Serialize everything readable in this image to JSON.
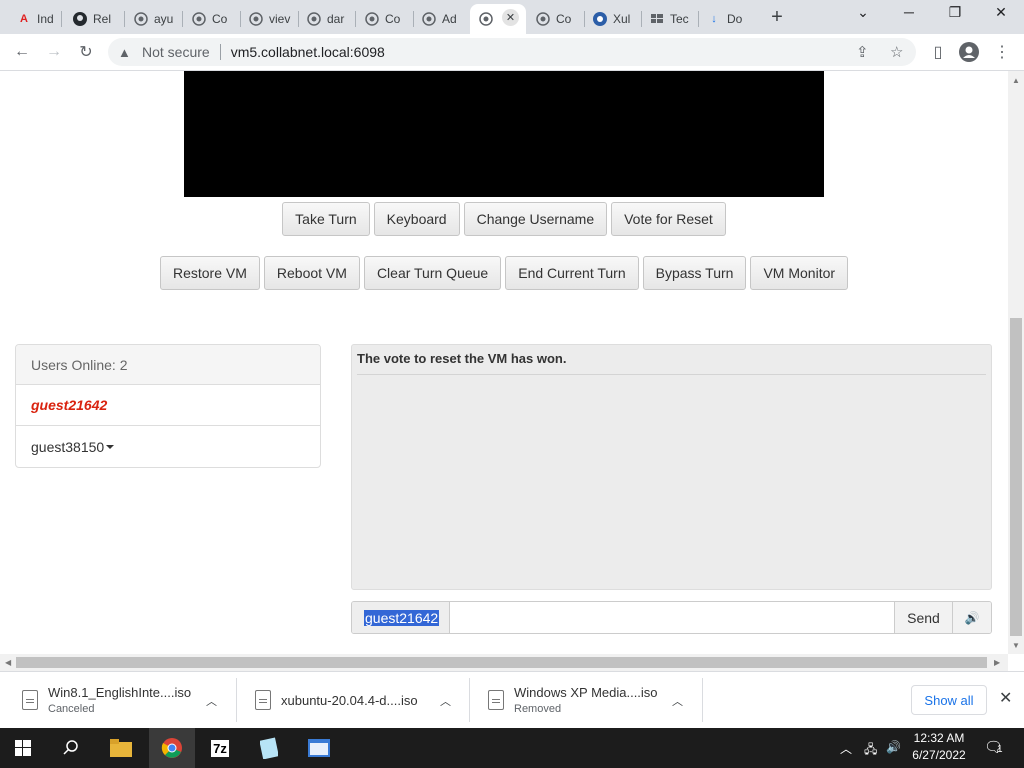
{
  "browser": {
    "tabs": [
      {
        "label": "Ind",
        "icon": "adobe-acrobat-icon"
      },
      {
        "label": "Rel",
        "icon": "github-icon"
      },
      {
        "label": "ayu",
        "icon": "globe-icon"
      },
      {
        "label": "Co",
        "icon": "globe-icon"
      },
      {
        "label": "viev",
        "icon": "globe-icon"
      },
      {
        "label": "dar",
        "icon": "globe-icon"
      },
      {
        "label": "Co",
        "icon": "globe-icon"
      },
      {
        "label": "Ad",
        "icon": "globe-icon"
      },
      {
        "label": "",
        "icon": "globe-icon",
        "active": true
      },
      {
        "label": "Co",
        "icon": "globe-icon"
      },
      {
        "label": "Xul",
        "icon": "xubuntu-icon"
      },
      {
        "label": "Tec",
        "icon": "windows-flag-icon"
      },
      {
        "label": "Do",
        "icon": "download-icon"
      }
    ],
    "security_label": "Not secure",
    "url": "vm5.collabnet.local:6098"
  },
  "vm": {
    "buttons_row1": [
      "Take Turn",
      "Keyboard",
      "Change Username",
      "Vote for Reset"
    ],
    "buttons_row2": [
      "Restore VM",
      "Reboot VM",
      "Clear Turn Queue",
      "End Current Turn",
      "Bypass Turn",
      "VM Monitor"
    ]
  },
  "users": {
    "header": "Users Online: 2",
    "list": [
      {
        "name": "guest21642",
        "is_self": true
      },
      {
        "name": "guest38150",
        "is_self": false
      }
    ]
  },
  "chat": {
    "messages": [
      "The vote to reset the VM has won."
    ],
    "username": "guest21642",
    "input_value": "",
    "send_label": "Send"
  },
  "downloads": [
    {
      "name": "Win8.1_EnglishInte....iso",
      "status": "Canceled"
    },
    {
      "name": "xubuntu-20.04.4-d....iso",
      "status": ""
    },
    {
      "name": "Windows XP Media....iso",
      "status": "Removed"
    }
  ],
  "downloads_show_all": "Show all",
  "taskbar": {
    "time": "12:32 AM",
    "date": "6/27/2022",
    "notification_count": "1"
  },
  "colors": {
    "self_user": "#d9230f",
    "vm_screen": "#000000",
    "link": "#1a73e8"
  }
}
